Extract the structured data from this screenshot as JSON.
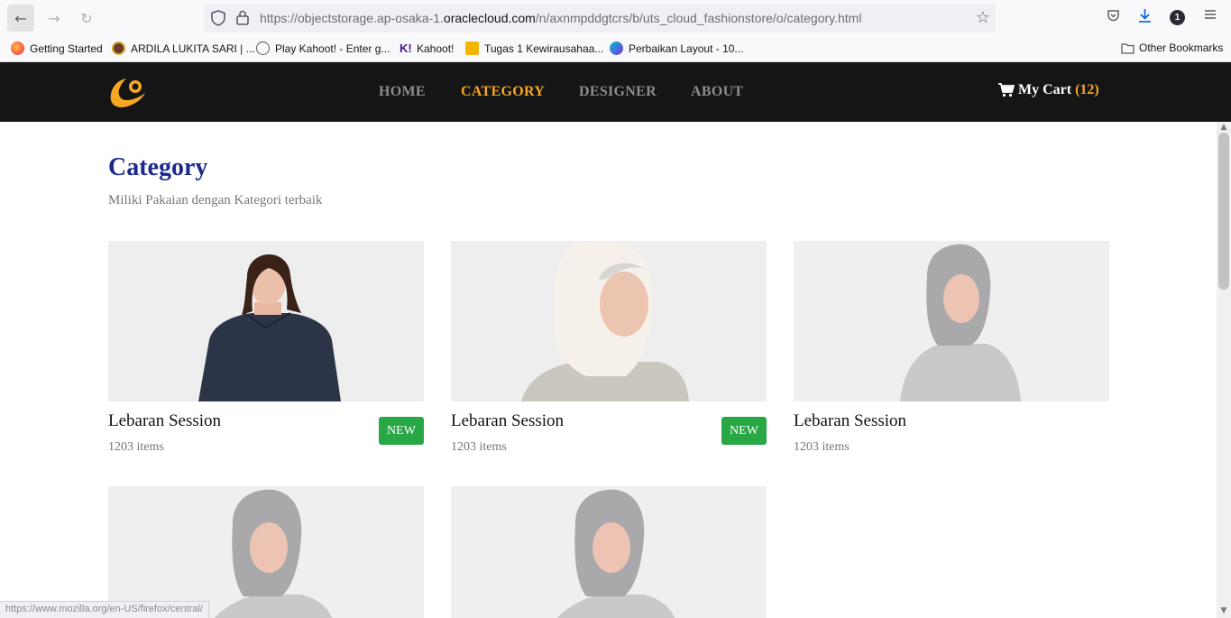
{
  "browser": {
    "url_prefix": "https://objectstorage.ap-osaka-1.",
    "url_domain": "oraclecloud.com",
    "url_path": "/n/axnmpddgtcrs/b/uts_cloud_fashionstore/o/category.html",
    "notification_count": "1",
    "bookmarks": [
      {
        "label": "Getting Started",
        "icon": "firefox-icon",
        "color": "#ff7139"
      },
      {
        "label": "ARDILA LUKITA SARI | ...",
        "icon": "university-icon",
        "color": "#6b3a2a"
      },
      {
        "label": "Play Kahoot! - Enter g...",
        "icon": "globe-icon",
        "color": "#5b5b66"
      },
      {
        "label": "Kahoot!",
        "icon": "kahoot-icon",
        "color": "#46178f"
      },
      {
        "label": "Tugas 1 Kewirausahaa...",
        "icon": "slides-icon",
        "color": "#f4b400"
      },
      {
        "label": "Perbaikan Layout - 10...",
        "icon": "canva-icon",
        "color": "#3d5ce4"
      }
    ],
    "other_bookmarks": "Other Bookmarks",
    "status_url": "https://www.mozilla.org/en-US/firefox/central/"
  },
  "site": {
    "accent_color": "#f5a623",
    "nav": [
      {
        "label": "HOME",
        "active": false
      },
      {
        "label": "CATEGORY",
        "active": true
      },
      {
        "label": "DESIGNER",
        "active": false
      },
      {
        "label": "ABOUT",
        "active": false
      }
    ],
    "cart_label": "My Cart",
    "cart_count": "(12)"
  },
  "main": {
    "title": "Category",
    "subtitle": "Miliki Pakaian dengan Kategori terbaik",
    "badge_color": "#28a745",
    "cards": [
      {
        "title": "Lebaran Session",
        "count": "1203 items",
        "badge": "NEW",
        "image": "model-denim-dress"
      },
      {
        "title": "Lebaran Session",
        "count": "1203 items",
        "badge": "NEW",
        "image": "model-white-hijab"
      },
      {
        "title": "Lebaran Session",
        "count": "1203 items",
        "badge": "",
        "image": "model-grey-hijab"
      },
      {
        "title": "",
        "count": "",
        "badge": "",
        "image": "model-grey-hijab"
      },
      {
        "title": "",
        "count": "",
        "badge": "",
        "image": "model-grey-hijab"
      }
    ]
  }
}
